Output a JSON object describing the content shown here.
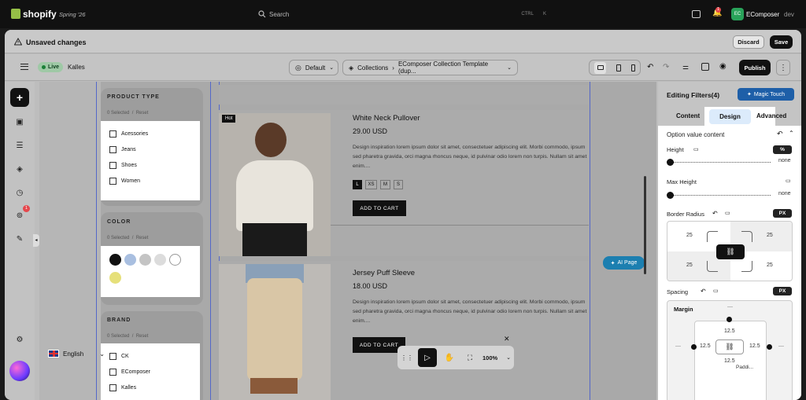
{
  "topbar": {
    "brand": "shopify",
    "edition": "Spring '26",
    "search_placeholder": "Search",
    "shortcut_ctrl": "CTRL",
    "shortcut_key": "K",
    "notification_count": "1",
    "store_initials": "EC",
    "store_name": "EComposer",
    "store_env": "dev"
  },
  "unsaved_bar": {
    "message": "Unsaved changes",
    "discard_label": "Discard",
    "save_label": "Save"
  },
  "toolbar": {
    "live_label": "Live",
    "theme_name": "Kalles",
    "language_select": "Default",
    "breadcrumb_parent": "Collections",
    "breadcrumb_current": "EComposer Collection Template (dup...",
    "publish_label": "Publish"
  },
  "left_rail": {
    "notification_count": "1"
  },
  "filters": {
    "product_type": {
      "title": "PRODUCT TYPE",
      "selected": "0 Selected",
      "reset": "Reset",
      "options": [
        "Acessories",
        "Jeans",
        "Shoes",
        "Women"
      ]
    },
    "color": {
      "title": "COLOR",
      "selected": "0 Selected",
      "reset": "Reset",
      "swatches": [
        "#111111",
        "#a9bfe0",
        "#c4c4c4",
        "#dcdcdc",
        "#ffffff",
        "#e6e07a"
      ]
    },
    "brand": {
      "title": "BRAND",
      "selected": "0 Selected",
      "reset": "Reset",
      "options": [
        "CK",
        "EComposer",
        "Kalles"
      ]
    }
  },
  "products": [
    {
      "badge": "Hot",
      "name": "White Neck Pullover",
      "price": "29.00 USD",
      "description": "Design inspiration lorem ipsum dolor sit amet, consectetuer adipiscing elit. Morbi commodo, ipsum sed pharetra gravida, orci magna rhoncus neque, id pulvinar odio lorem non turpis. Nullam sit amet enim....",
      "sizes": [
        "L",
        "XS",
        "M",
        "S"
      ],
      "add_to_cart": "ADD TO CART"
    },
    {
      "name": "Jersey Puff Sleeve",
      "price": "18.00 USD",
      "description": "Design inspiration lorem ipsum dolor sit amet, consectetuer adipiscing elit. Morbi commodo, ipsum sed pharetra gravida, orci magna rhoncus neque, id pulvinar odio lorem non turpis. Nullam sit amet enim....",
      "add_to_cart": "ADD TO CART"
    }
  ],
  "ai_page_label": "AI Page",
  "language_switch": "English",
  "zoom_toolbar": {
    "zoom": "100%"
  },
  "panel": {
    "title": "Editing Filters(4)",
    "magic_touch": "Magic Touch",
    "tabs": [
      "Content",
      "Design",
      "Advanced"
    ],
    "active_tab": "Design",
    "section_title": "Option value content",
    "height_label": "Height",
    "height_unit": "%",
    "height_value": "none",
    "max_height_label": "Max Height",
    "max_height_value": "none",
    "border_radius_label": "Border Radius",
    "border_radius_unit": "PX",
    "radius_values": [
      "25",
      "25",
      "25",
      "25"
    ],
    "spacing_label": "Spacing",
    "spacing_unit": "PX",
    "margin_label": "Margin",
    "margin_top": "12.5",
    "margin_left": "12.5",
    "margin_right": "12.5",
    "margin_bottom": "12.5",
    "dash": "—",
    "padding_partial": "Paddi..."
  }
}
